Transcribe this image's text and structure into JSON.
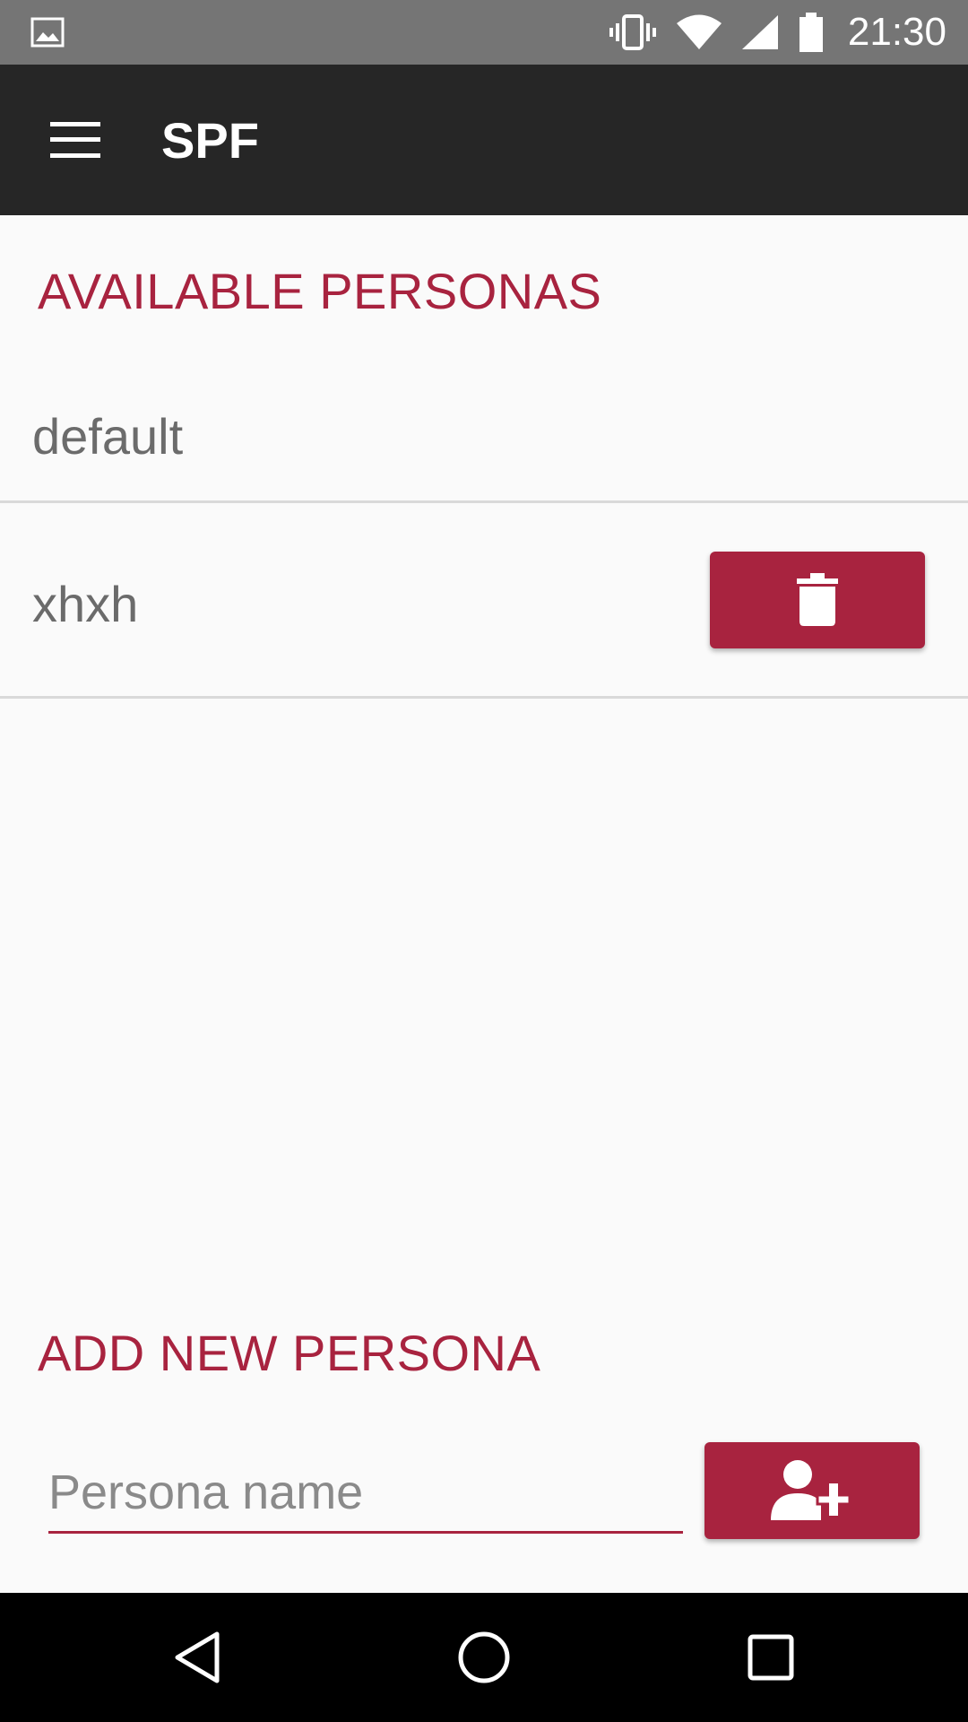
{
  "status_bar": {
    "time": "21:30",
    "icons": [
      "image-notification-icon",
      "vibrate-icon",
      "wifi-icon",
      "cellular-signal-icon",
      "battery-icon"
    ]
  },
  "app_bar": {
    "title": "SPF",
    "menu_icon": "hamburger-menu-icon"
  },
  "available_section": {
    "header": "AVAILABLE PERSONAS",
    "personas": [
      {
        "name": "default",
        "deletable": false
      },
      {
        "name": "xhxh",
        "deletable": true,
        "delete_icon": "trash-icon"
      }
    ]
  },
  "add_section": {
    "header": "ADD NEW PERSONA",
    "input_placeholder": "Persona name",
    "input_value": "",
    "add_icon": "add-user-icon"
  },
  "nav_bar": {
    "icons": [
      "back-icon",
      "home-icon",
      "recents-icon"
    ]
  },
  "colors": {
    "accent": "#a8233f",
    "app_bar": "#262626",
    "status_bar": "#757575",
    "background": "#fafafa"
  }
}
